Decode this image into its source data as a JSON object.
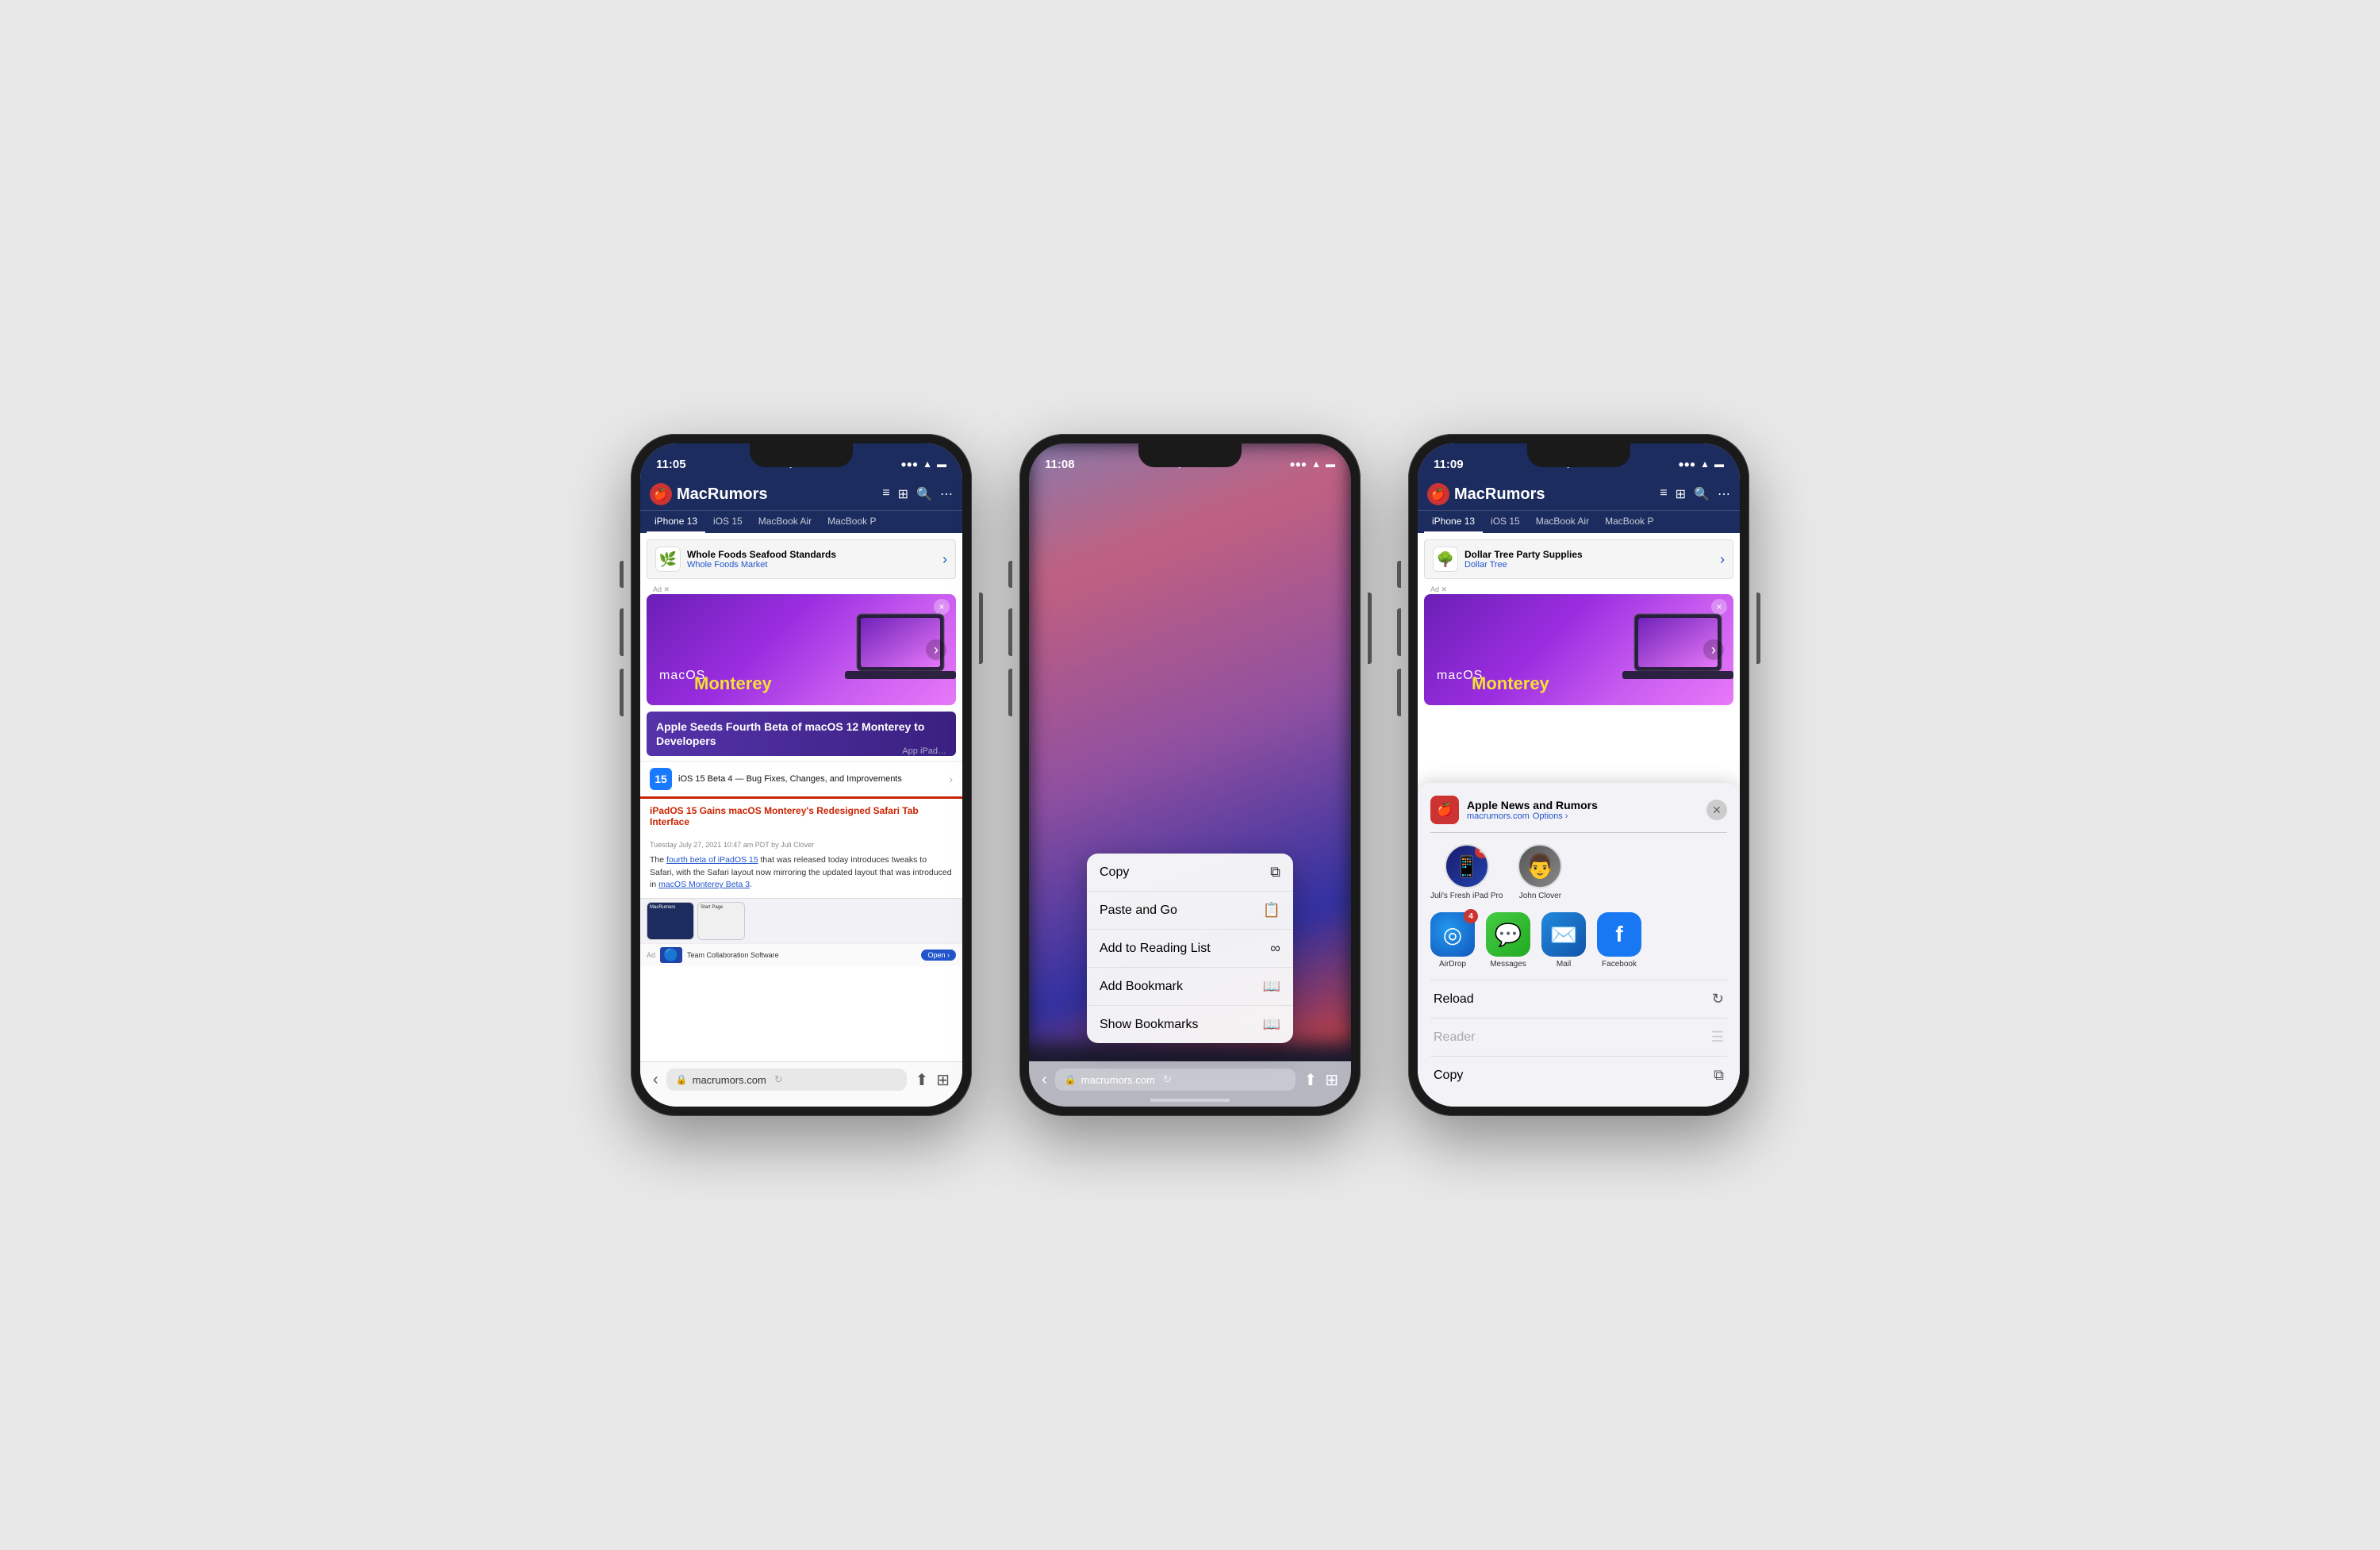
{
  "phones": [
    {
      "id": "phone1",
      "status": {
        "time": "11:05",
        "location": true,
        "signal": "●●●",
        "wifi": "wifi",
        "battery": "battery"
      },
      "navbar": {
        "title": "MacRumors",
        "tabs": [
          "iPhone 13",
          "iOS 15",
          "MacBook Air",
          "MacBook P"
        ]
      },
      "ad": {
        "logo": "🌿",
        "title": "Whole Foods Seafood Standards",
        "subtitle": "Whole Foods Market",
        "type": "wf"
      },
      "hero": {
        "macos": "macOS",
        "monterey": "Monterey",
        "closeBtn": "×"
      },
      "articles": [
        {
          "title": "Apple Seeds Fourth Beta of macOS 12 Monterey to Developers",
          "type": "headline"
        },
        {
          "icon": "15",
          "text": "iOS 15 Beta 4 — Bug Fixes, Changes, and Improvements",
          "type": "news"
        },
        {
          "text": "iPadOS 15 Gains macOS Monterey's Redesigned Safari Tab Interface",
          "type": "red"
        }
      ],
      "articleMeta": "Tuesday July 27, 2021 10:47 am PDT by Juli Clover",
      "articleBody": "The fourth beta of iPadOS 15 that was released today introduces tweaks to Safari, with the Safari layout now mirroring the updated layout that was introduced in macOS Monterey Beta 3.",
      "links": [
        "fourth beta of iPadOS 15",
        "macOS Monterey Beta 3"
      ],
      "bottomAd": {
        "text": "Team Collaboration Software",
        "openLabel": "Open"
      },
      "urlBar": "macrumors.com"
    },
    {
      "id": "phone2",
      "status": {
        "time": "11:08",
        "location": true
      },
      "contextMenu": {
        "items": [
          {
            "label": "Copy",
            "icon": "📋"
          },
          {
            "label": "Paste and Go",
            "icon": "📄"
          },
          {
            "label": "Add to Reading List",
            "icon": "∞"
          },
          {
            "label": "Add Bookmark",
            "icon": "📖"
          },
          {
            "label": "Show Bookmarks",
            "icon": "📖"
          }
        ]
      },
      "urlBar": "macrumors.com"
    },
    {
      "id": "phone3",
      "status": {
        "time": "11:09",
        "location": true
      },
      "navbar": {
        "title": "MacRumors",
        "tabs": [
          "iPhone 13",
          "iOS 15",
          "MacBook Air",
          "MacBook P"
        ]
      },
      "ad": {
        "logo": "🌳",
        "title": "Dollar Tree Party Supplies",
        "subtitle": "Dollar Tree",
        "type": "dt"
      },
      "hero": {
        "macos": "macOS",
        "monterey": "Monterey",
        "closeBtn": "×"
      },
      "shareSheet": {
        "siteName": "Apple News and Rumors",
        "siteUrl": "macrumors.com",
        "optionsLabel": "Options ›",
        "people": [
          {
            "name": "Juli's Fresh iPad Pro",
            "type": "ipad",
            "badge": "4"
          },
          {
            "name": "John Clover",
            "type": "john"
          }
        ],
        "apps": [
          {
            "name": "AirDrop",
            "type": "airdrop",
            "badge": "4"
          },
          {
            "name": "Messages",
            "type": "messages"
          },
          {
            "name": "Mail",
            "type": "mail"
          },
          {
            "name": "Facebook",
            "type": "facebook"
          }
        ],
        "actions": [
          {
            "label": "Reload",
            "icon": "↻",
            "active": true
          },
          {
            "label": "Reader",
            "icon": "☰",
            "active": false
          },
          {
            "label": "Copy",
            "icon": "📋",
            "active": true
          }
        ]
      },
      "urlBar": "macrumors.com"
    }
  ]
}
